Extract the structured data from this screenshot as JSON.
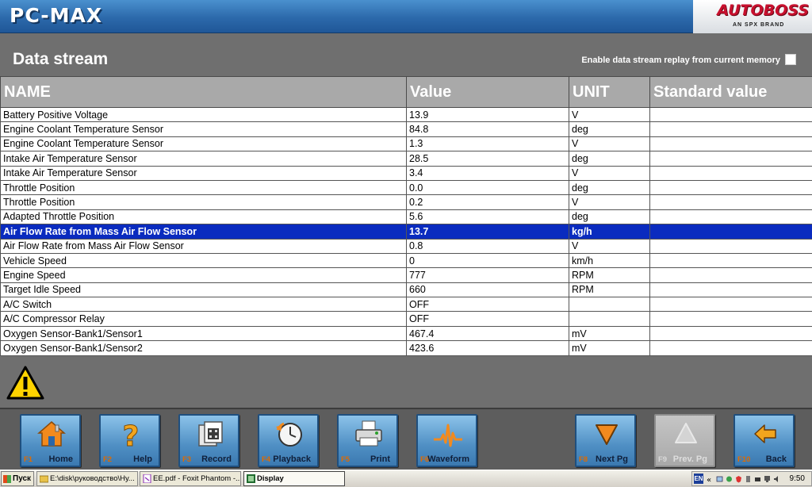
{
  "app": {
    "title": "PC-MAX",
    "brand": "AUTOBOSS",
    "brand_sub": "AN SPX BRAND"
  },
  "page": {
    "title": "Data stream",
    "replay_label": "Enable data stream replay from current memory",
    "replay_checked": false
  },
  "table": {
    "headers": [
      "NAME",
      "Value",
      "UNIT",
      "Standard value"
    ],
    "selected_row_index": 8,
    "rows": [
      {
        "name": "Battery Positive Voltage",
        "value": "13.9",
        "unit": "V",
        "standard": ""
      },
      {
        "name": "Engine Coolant Temperature Sensor",
        "value": "84.8",
        "unit": "deg",
        "standard": ""
      },
      {
        "name": "Engine Coolant Temperature Sensor",
        "value": "1.3",
        "unit": "V",
        "standard": ""
      },
      {
        "name": "Intake Air Temperature Sensor",
        "value": "28.5",
        "unit": "deg",
        "standard": ""
      },
      {
        "name": "Intake Air Temperature Sensor",
        "value": "3.4",
        "unit": "V",
        "standard": ""
      },
      {
        "name": "Throttle Position",
        "value": "0.0",
        "unit": "deg",
        "standard": ""
      },
      {
        "name": "Throttle Position",
        "value": "0.2",
        "unit": "V",
        "standard": ""
      },
      {
        "name": "Adapted Throttle Position",
        "value": "5.6",
        "unit": "deg",
        "standard": ""
      },
      {
        "name": "Air Flow Rate from Mass Air Flow Sensor",
        "value": "13.7",
        "unit": "kg/h",
        "standard": ""
      },
      {
        "name": "Air Flow Rate from Mass Air Flow Sensor",
        "value": "0.8",
        "unit": "V",
        "standard": ""
      },
      {
        "name": "Vehicle Speed",
        "value": "0",
        "unit": "km/h",
        "standard": ""
      },
      {
        "name": "Engine Speed",
        "value": "777",
        "unit": "RPM",
        "standard": ""
      },
      {
        "name": "Target Idle Speed",
        "value": "660",
        "unit": "RPM",
        "standard": ""
      },
      {
        "name": "A/C Switch",
        "value": "OFF",
        "unit": "",
        "standard": ""
      },
      {
        "name": "A/C Compressor Relay",
        "value": "OFF",
        "unit": "",
        "standard": ""
      },
      {
        "name": "Oxygen Sensor-Bank1/Sensor1",
        "value": "467.4",
        "unit": "mV",
        "standard": ""
      },
      {
        "name": "Oxygen Sensor-Bank1/Sensor2",
        "value": "423.6",
        "unit": "mV",
        "standard": ""
      }
    ]
  },
  "toolbar": {
    "buttons": [
      {
        "key": "F1",
        "label": "Home",
        "icon": "home-icon",
        "enabled": true
      },
      {
        "key": "F2",
        "label": "Help",
        "icon": "help-icon",
        "enabled": true
      },
      {
        "key": "F3",
        "label": "Record",
        "icon": "record-icon",
        "enabled": true
      },
      {
        "key": "F4",
        "label": "Playback",
        "icon": "playback-icon",
        "enabled": true
      },
      {
        "key": "F5",
        "label": "Print",
        "icon": "printer-icon",
        "enabled": true
      },
      {
        "key": "F6",
        "label": "Waveform",
        "icon": "waveform-icon",
        "enabled": true
      },
      {
        "key": "F8",
        "label": "Next Pg",
        "icon": "next-page-icon",
        "enabled": true
      },
      {
        "key": "F9",
        "label": "Prev. Pg",
        "icon": "prev-page-icon",
        "enabled": false
      },
      {
        "key": "F10",
        "label": "Back",
        "icon": "back-arrow-icon",
        "enabled": true
      }
    ]
  },
  "taskbar": {
    "start_label": "Пуск",
    "tasks": [
      {
        "label": "E:\\disk\\руководство\\Ну...",
        "icon": "folder-icon",
        "active": false
      },
      {
        "label": "EE.pdf - Foxit Phantom -...",
        "icon": "pdf-icon",
        "active": false
      },
      {
        "label": "Display",
        "icon": "display-app-icon",
        "active": true
      }
    ],
    "language": "EN",
    "clock": "9:50"
  },
  "colors": {
    "header_blue": "#2c69ab",
    "selected_row": "#0a2bbf",
    "brand_red": "#c8102e",
    "fkey_orange": "#e06b00"
  }
}
